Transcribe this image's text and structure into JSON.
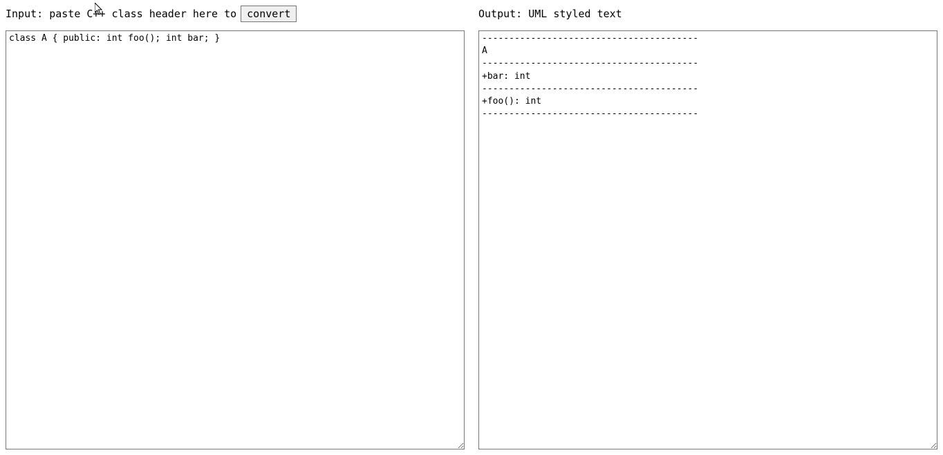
{
  "input": {
    "label": "Input: paste C++ class header here to ",
    "button_label": "convert",
    "textarea_value": "class A { public: int foo(); int bar; }"
  },
  "output": {
    "label": "Output: UML styled text",
    "textarea_value": "----------------------------------------\nA\n----------------------------------------\n+bar: int\n----------------------------------------\n+foo(): int\n----------------------------------------"
  }
}
